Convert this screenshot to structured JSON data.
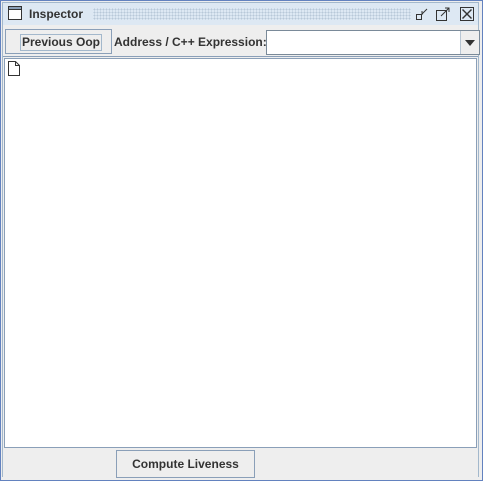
{
  "window": {
    "title": "Inspector",
    "icon": "window-icon",
    "controls": [
      "iconify-icon",
      "maximize-icon",
      "close-icon"
    ]
  },
  "toolbar": {
    "previous_oop_label": "Previous Oop",
    "address_label": "Address / C++ Expression:",
    "address_value": "",
    "dropdown_icon": "chevron-down-icon"
  },
  "tree": {
    "root_icon": "file-icon"
  },
  "bottom": {
    "compute_liveness_label": "Compute Liveness"
  },
  "colors": {
    "frame_border": "#6382bf",
    "titlebar_bg": "#dde8f3",
    "panel_bg": "#eeeeee",
    "content_bg": "#ffffff"
  }
}
